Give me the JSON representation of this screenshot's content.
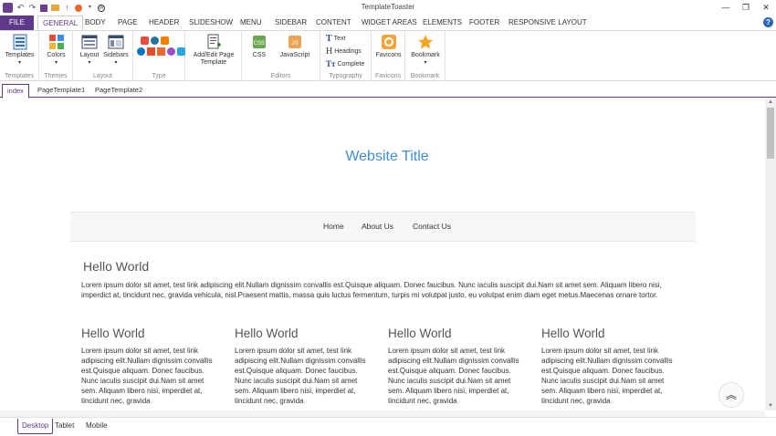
{
  "window": {
    "title": "TemplateToaster"
  },
  "menu": {
    "file": "FILE",
    "tabs": [
      "GENERAL",
      "BODY",
      "PAGE",
      "HEADER",
      "SLIDESHOW",
      "MENU",
      "SIDEBAR",
      "CONTENT",
      "WIDGET AREAS",
      "ELEMENTS",
      "FOOTER",
      "RESPONSIVE LAYOUT"
    ],
    "active_tab": "GENERAL"
  },
  "ribbon": {
    "templates": {
      "button": "Templates",
      "group": "Templates"
    },
    "themes": {
      "button": "Colors",
      "group": "Themes"
    },
    "layout": {
      "layout_btn": "Layout",
      "sidebars_btn": "Sidebars",
      "group": "Layout"
    },
    "type": {
      "group": "Type"
    },
    "addedit": {
      "line1": "Add/Edit Page",
      "line2": "Template"
    },
    "editors": {
      "css": "CSS",
      "js": "JavaScript",
      "group": "Editors"
    },
    "typography": {
      "text": "Text",
      "headings": "Headings",
      "complete": "Complete",
      "group": "Typography"
    },
    "favicons": {
      "button": "Favicons",
      "group": "Favicons"
    },
    "bookmark": {
      "button": "Bookmark",
      "group": "Bookmark"
    }
  },
  "page_tabs": [
    "index",
    "PageTemplate1",
    "PageTemplate2"
  ],
  "site": {
    "title": "Website Title",
    "nav": [
      "Home",
      "About Us",
      "Contact Us"
    ],
    "main_heading": "Hello World",
    "main_paragraph": "Lorem ipsum dolor sit amet, test link adipiscing elit.Nullam dignissim convallis est.Quisque aliquam. Donec faucibus. Nunc iaculis suscipit dui.Nam sit amet sem. Aliquam libero nisi, imperdict at, tincidunt nec, gravida vehicula, nisl.Praesent mattis, massa quis luctus fermentum, turpis mi volutpat justo, eu volutpat enim diam eget metus.Maecenas ornare tortor.",
    "columns": [
      {
        "heading": "Hello World",
        "text": "Lorem ipsum dolor sit amet, test link adipiscing elit.Nullam dignissim convallis est.Quisque aliquam. Donec faucibus. Nunc iaculis suscipit dui.Nam sit amet sem. Aliquam libero nisi, imperdiet at, tincidunt nec, gravida"
      },
      {
        "heading": "Hello World",
        "text": "Lorem ipsum dolor sit amet, test link adipiscing elit.Nullam dignissim convallis est.Quisque aliquam. Donec faucibus. Nunc iaculis suscipit dui.Nam sit amet sem. Aliquam libero nisi, imperdiet at, tincidunt nec, gravida"
      },
      {
        "heading": "Hello World",
        "text": "Lorem ipsum dolor sit amet, test link adipiscing elit.Nullam dignissim convallis est.Quisque aliquam. Donec faucibus. Nunc iaculis suscipit dui.Nam sit amet sem. Aliquam libero nisi, imperdiet at, tincidunt nec, gravida"
      },
      {
        "heading": "Hello World",
        "text": "Lorem ipsum dolor sit amet, test link adipiscing elit.Nullam dignissim convallis est.Quisque aliquam. Donec faucibus. Nunc iaculis suscipit dui.Nam sit amet sem. Aliquam libero nisi, imperdiet at, tincidunt nec, gravida"
      }
    ]
  },
  "device_tabs": [
    "Desktop",
    "Tablet",
    "Mobile"
  ],
  "colors": {
    "brand": "#5f3a8a",
    "title": "#3f8fd2"
  }
}
